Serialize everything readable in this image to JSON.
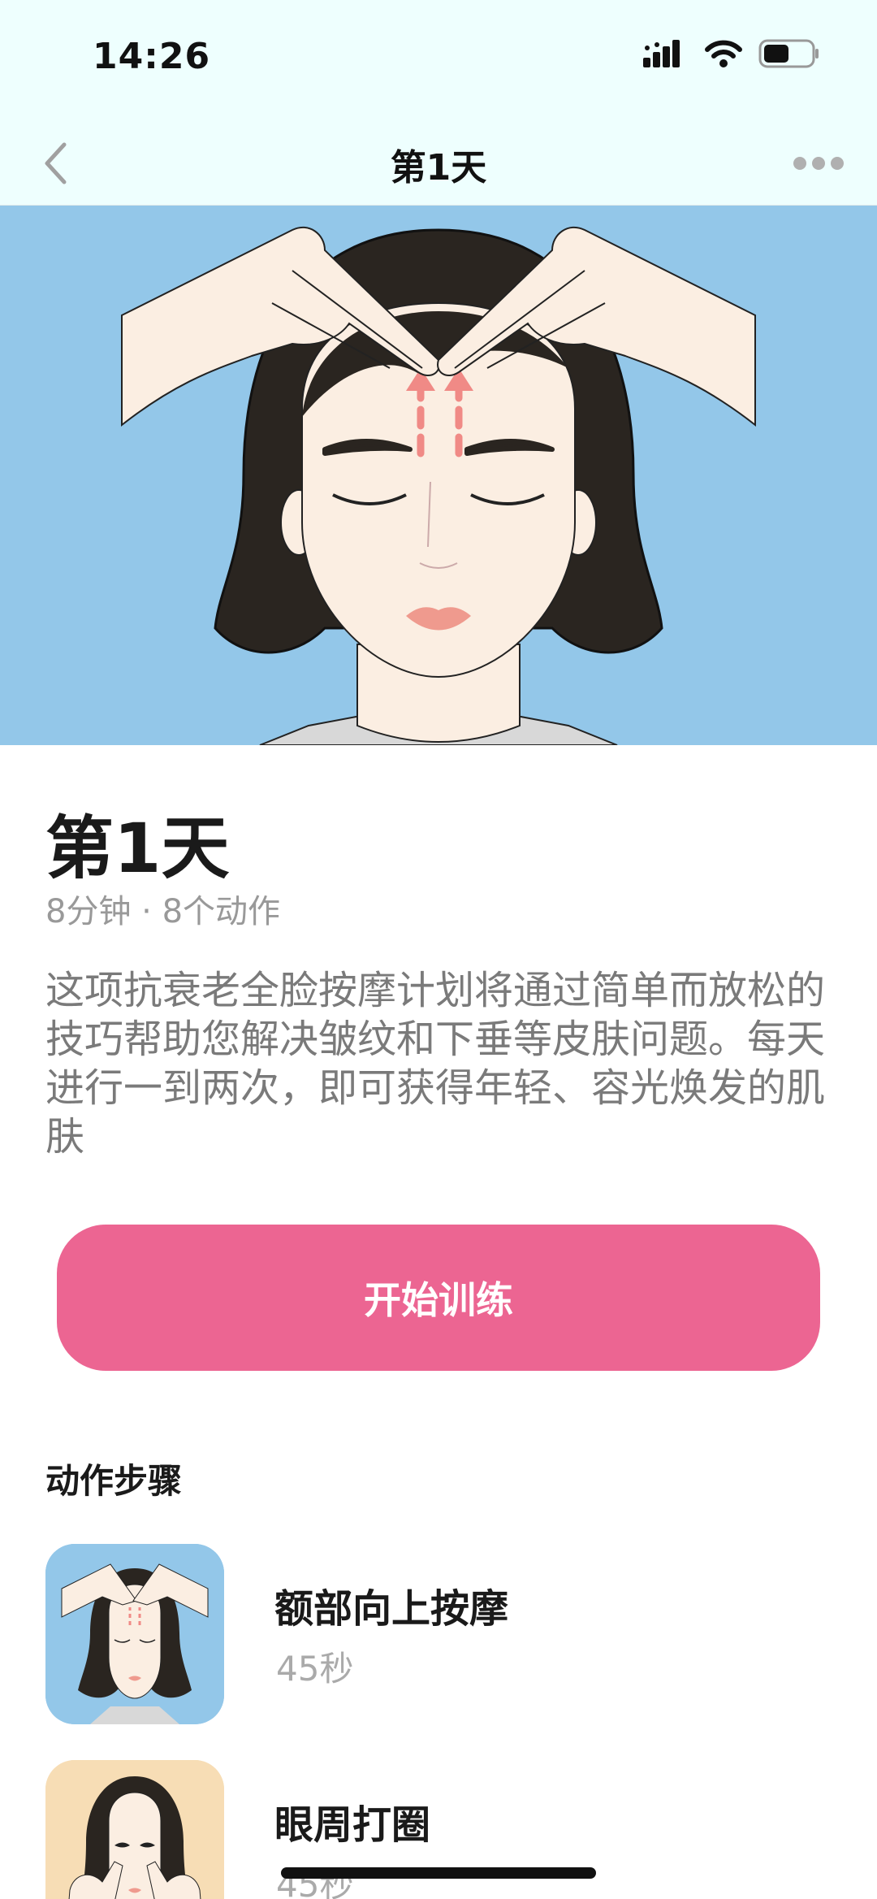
{
  "status_bar": {
    "time": "14:26"
  },
  "nav": {
    "title": "第1天"
  },
  "plan": {
    "title": "第1天",
    "meta": "8分钟 · 8个动作",
    "description": "这项抗衰老全脸按摩计划将通过简单而放松的技巧帮助您解决皱纹和下垂等皮肤问题。每天进行一到两次，即可获得年轻、容光焕发的肌肤"
  },
  "start_button": {
    "label": "开始训练"
  },
  "steps": {
    "title": "动作步骤",
    "items": [
      {
        "name": "额部向上按摩",
        "duration": "45秒",
        "thumb_bg": "#93c7e9"
      },
      {
        "name": "眼周打圈",
        "duration": "45秒",
        "thumb_bg": "#f7ddb5"
      }
    ]
  },
  "colors": {
    "accent": "#ec6592",
    "header_bg": "#eefffe",
    "hero_bg": "#93c7e9"
  }
}
